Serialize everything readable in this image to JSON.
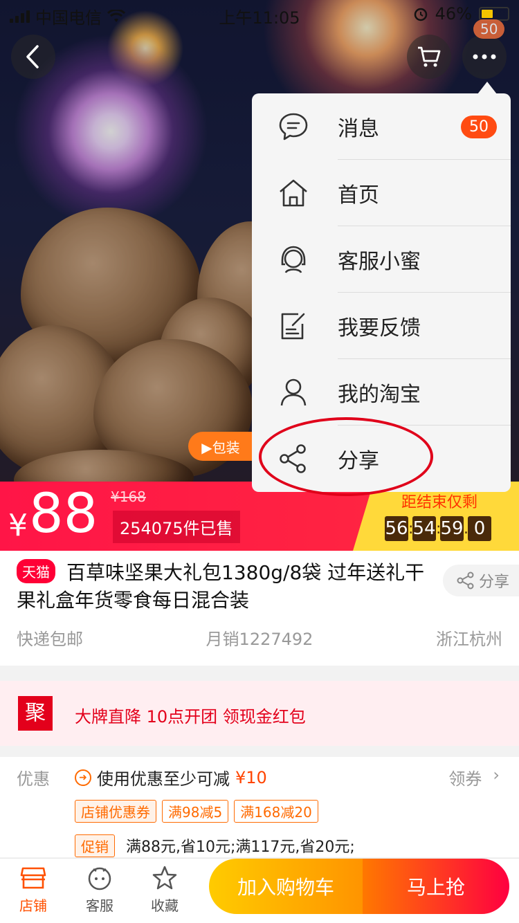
{
  "status_bar": {
    "carrier": "中国电信",
    "time": "上午11:05",
    "battery": "46%"
  },
  "nav": {
    "cart_badge": "50"
  },
  "menu": {
    "items": [
      {
        "label": "消息",
        "icon": "message-icon",
        "badge": "50"
      },
      {
        "label": "首页",
        "icon": "home-icon"
      },
      {
        "label": "客服小蜜",
        "icon": "customer-service-icon"
      },
      {
        "label": "我要反馈",
        "icon": "feedback-icon"
      },
      {
        "label": "我的淘宝",
        "icon": "user-icon"
      },
      {
        "label": "分享",
        "icon": "share-icon"
      }
    ]
  },
  "hero": {
    "video_chip": "▶包装"
  },
  "price": {
    "currency": "¥",
    "current": "88",
    "original": "¥168",
    "sold": "254075件已售"
  },
  "countdown": {
    "title": "距结束仅剩",
    "hours": "56",
    "minutes": "54",
    "seconds": "59",
    "tenths": "0"
  },
  "product": {
    "badge": "天猫",
    "title": "百草味坚果大礼包1380g/8袋 过年送礼干果礼盒年货零食每日混合装",
    "share": "分享",
    "shipping": "快递包邮",
    "monthly_sales": "月销1227492",
    "location": "浙江杭州"
  },
  "promo": {
    "ju_label": "聚",
    "text": "大牌直降 10点开团  领现金红包"
  },
  "coupon": {
    "label": "优惠",
    "discount_prefix": "使用优惠至少可减",
    "discount_amount": "¥10",
    "get_label": "领券",
    "tags": [
      "店铺优惠券",
      "满98减5",
      "满168减20"
    ],
    "promo_tag": "促销",
    "promo_text": "满88元,省10元;满117元,省20元;"
  },
  "bottom_bar": {
    "store": "店铺",
    "service": "客服",
    "favorite": "收藏",
    "add_cart": "加入购物车",
    "buy_now": "马上抢"
  },
  "colors": {
    "accent": "#ff1547",
    "countdown_bg": "#ffd93a",
    "tmall": "#ff0036",
    "oval": "#e0001a"
  }
}
